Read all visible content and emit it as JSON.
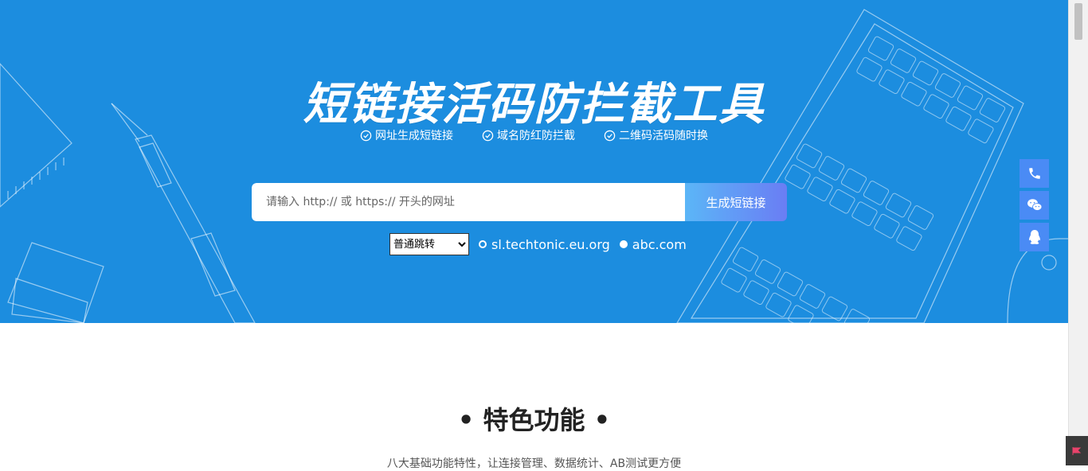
{
  "hero": {
    "title": "短链接活码防拦截工具",
    "features": [
      {
        "label": "网址生成短链接",
        "icon": "check-circle-icon"
      },
      {
        "label": "域名防红防拦截",
        "icon": "check-circle-icon"
      },
      {
        "label": "二维码活码随时换",
        "icon": "check-circle-icon"
      }
    ],
    "background_color": "#1c8ddf"
  },
  "search": {
    "placeholder": "请输入 http:// 或 https:// 开头的网址",
    "value": "",
    "button_label": "生成短链接"
  },
  "options": {
    "jump_mode": "普通跳转",
    "domains": [
      {
        "label": "sl.techtonic.eu.org",
        "selected": false
      },
      {
        "label": "abc.com",
        "selected": true
      }
    ]
  },
  "float_bar": [
    {
      "name": "phone-icon"
    },
    {
      "name": "wechat-icon"
    },
    {
      "name": "qq-icon"
    }
  ],
  "section": {
    "title": "• 特色功能 •",
    "subtitle": "八大基础功能特性，让连接管理、数据统计、AB测试更方便"
  }
}
